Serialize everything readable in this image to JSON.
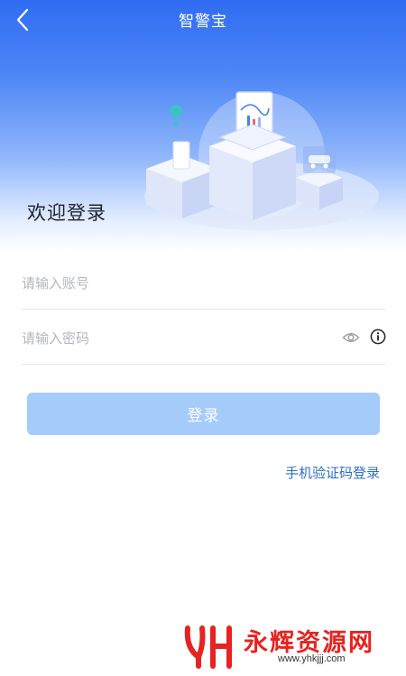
{
  "nav": {
    "title": "智警宝",
    "back_icon": "chevron-left-icon"
  },
  "hero": {
    "welcome_text": "欢迎登录"
  },
  "form": {
    "account_placeholder": "请输入账号",
    "account_value": "",
    "password_placeholder": "请输入密码",
    "password_value": "",
    "login_label": "登录",
    "sms_login_label": "手机验证码登录"
  },
  "watermark": {
    "name": "永辉资源网",
    "url": "www.yhkjjj.com"
  },
  "colors": {
    "primary": "#2f6cf3",
    "button_disabled": "#a5cbfb",
    "link": "#2f6fc4",
    "watermark": "#e52421"
  }
}
